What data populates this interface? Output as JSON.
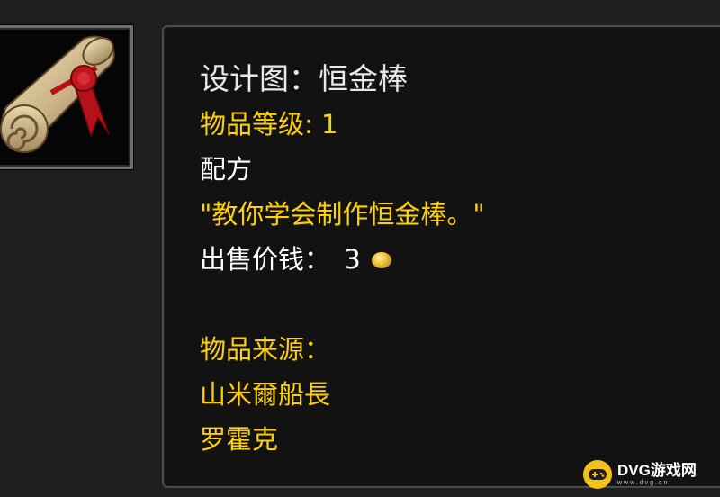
{
  "item": {
    "icon": "recipe-scroll-icon",
    "title": "设计图：恒金棒",
    "item_level": "物品等级: 1",
    "type": "配方",
    "description": "\"教你学会制作恒金棒。\"",
    "sell_price_label": "出售价钱：",
    "sell_price_value": "3",
    "sell_price_currency_icon": "gold-coin-icon",
    "source_label": "物品来源：",
    "sources": [
      "山米爾船長",
      "罗霍克"
    ]
  },
  "watermark": {
    "name": "DVG游戏网",
    "url": "www.dvg.cn",
    "color": "#f3c21a"
  },
  "colors": {
    "title": "#e8e8e8",
    "gold_text": "#ffd100",
    "white_text": "#ffffff",
    "tooltip_bg": "#121212",
    "page_bg": "#1f1f1f"
  }
}
